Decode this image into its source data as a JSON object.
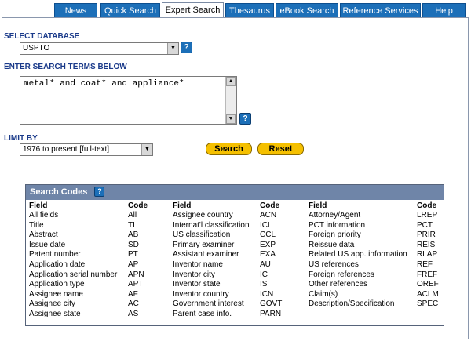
{
  "tabs": [
    "News",
    "Quick Search",
    "Expert Search",
    "Thesaurus",
    "eBook Search",
    "Reference Services",
    "Help"
  ],
  "active_tab": "Expert Search",
  "database": {
    "label": "SELECT DATABASE",
    "selected": "USPTO"
  },
  "search_terms": {
    "label": "ENTER SEARCH TERMS BELOW",
    "value": "metal* and coat* and appliance*"
  },
  "limit_by": {
    "label": "LIMIT BY",
    "selected": "1976 to present [full-text]"
  },
  "buttons": {
    "search": "Search",
    "reset": "Reset"
  },
  "codes": {
    "title": "Search Codes",
    "field_header": "Field",
    "code_header": "Code",
    "columns": [
      {
        "fields": [
          "All fields",
          "Title",
          "Abstract",
          "Issue date",
          "Patent number",
          "Application date",
          "Application serial number",
          "Application type",
          "Assignee name",
          "Assignee city",
          "Assignee state"
        ],
        "codes": [
          "All",
          "TI",
          "AB",
          "SD",
          "PT",
          "AP",
          "APN",
          "APT",
          "AF",
          "AC",
          "AS"
        ]
      },
      {
        "fields": [
          "Assignee country",
          "Internat'l classification",
          "US classification",
          "Primary examiner",
          "Assistant examiner",
          "Inventor name",
          "Inventor city",
          "Inventor state",
          "Inventor country",
          "Government interest",
          "Parent case info."
        ],
        "codes": [
          "ACN",
          "ICL",
          "CCL",
          "EXP",
          "EXA",
          "AU",
          "IC",
          "IS",
          "ICN",
          "GOVT",
          "PARN"
        ]
      },
      {
        "fields": [
          "Attorney/Agent",
          "PCT information",
          "Foreign priority",
          "Reissue data",
          "Related US app. information",
          "US references",
          "Foreign references",
          "Other references",
          "Claim(s)",
          "Description/Specification"
        ],
        "codes": [
          "LREP",
          "PCT",
          "PRIR",
          "REIS",
          "RLAP",
          "REF",
          "FREF",
          "OREF",
          "ACLM",
          "SPEC"
        ]
      }
    ]
  }
}
